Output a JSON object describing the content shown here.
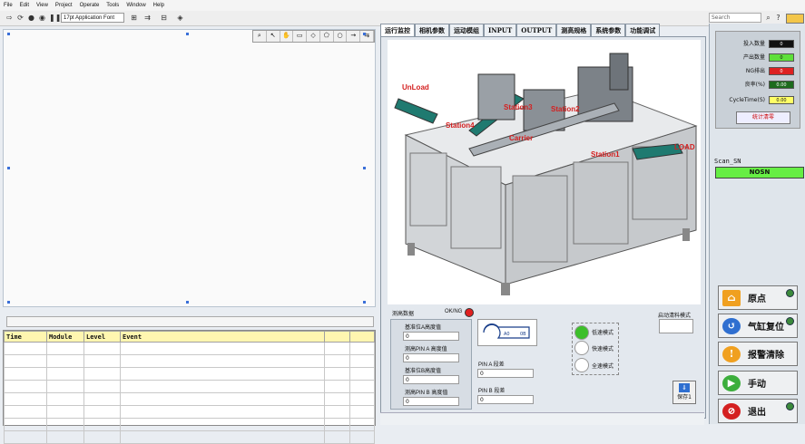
{
  "menu": [
    "File",
    "Edit",
    "View",
    "Project",
    "Operate",
    "Tools",
    "Window",
    "Help"
  ],
  "toolbar": {
    "font": "17pt Application Font",
    "search_placeholder": "Search"
  },
  "event_table": {
    "headers": [
      "Time",
      "Module",
      "Level",
      "Event"
    ]
  },
  "tabs": [
    "运行监控",
    "相机参数",
    "运动模组",
    "INPUT",
    "OUTPUT",
    "测高规格",
    "系统参数",
    "功能调试"
  ],
  "machine_labels": {
    "unload": "UnLoad",
    "station3": "Station3",
    "station2": "Station2",
    "station4": "Station4",
    "carrier": "Carrier",
    "station1": "Station1",
    "load": "LOAD"
  },
  "measure": {
    "title": "测高数据",
    "okng": "OK/NG",
    "base_a_label": "基准位A高度值",
    "base_a_value": "0",
    "pin_a_label": "测高PIN A 高度值",
    "pin_a_value": "0",
    "base_b_label": "基准位B高度值",
    "base_b_value": "0",
    "pin_b_label": "测高PIN B 高度值",
    "pin_b_value": "0",
    "pin_a_diff_label": "PIN A 段差",
    "pin_a_diff_value": "0",
    "pin_b_diff_label": "PIN B 段差",
    "pin_b_diff_value": "0"
  },
  "modes": {
    "low": "低速模式",
    "fast": "快速模式",
    "full": "全速模式"
  },
  "clear_mode_label": "启动清料模式",
  "save_label": "保存1",
  "counts": [
    {
      "label": "投入数量",
      "value": "0"
    },
    {
      "label": "产出数量",
      "value": "0"
    },
    {
      "label": "NG排出",
      "value": "0"
    },
    {
      "label": "良率(%)",
      "value": "0.00"
    },
    {
      "label": "CycleTime(S)",
      "value": "0.00"
    }
  ],
  "stat_clear": "统计清零",
  "scan": {
    "label": "Scan_SN",
    "value": "NOSN"
  },
  "buttons": {
    "home": "原点",
    "cylinder": "气缸复位",
    "alarm": "报警清除",
    "manual": "手动",
    "exit": "退出"
  },
  "colors": {
    "ok_green": "#66ee44",
    "ng_red": "#dd2222",
    "led_red": "#e02020"
  }
}
